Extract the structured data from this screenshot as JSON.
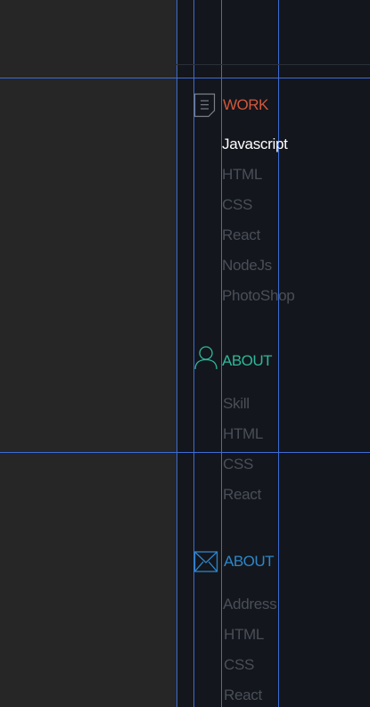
{
  "sections": [
    {
      "title": "WORK",
      "color": "#d2573a",
      "icon": "document-icon",
      "items": [
        "Javascript",
        "HTML",
        "CSS",
        "React",
        "NodeJs",
        "PhotoShop"
      ],
      "active_item": "Javascript"
    },
    {
      "title": "ABOUT",
      "color": "#2fb79a",
      "icon": "user-icon",
      "items": [
        "Skill",
        "HTML",
        "CSS",
        "React"
      ]
    },
    {
      "title": "ABOUT",
      "color": "#2e86c9",
      "icon": "mail-icon",
      "items": [
        "Address",
        "HTML",
        "CSS",
        "React"
      ]
    }
  ]
}
